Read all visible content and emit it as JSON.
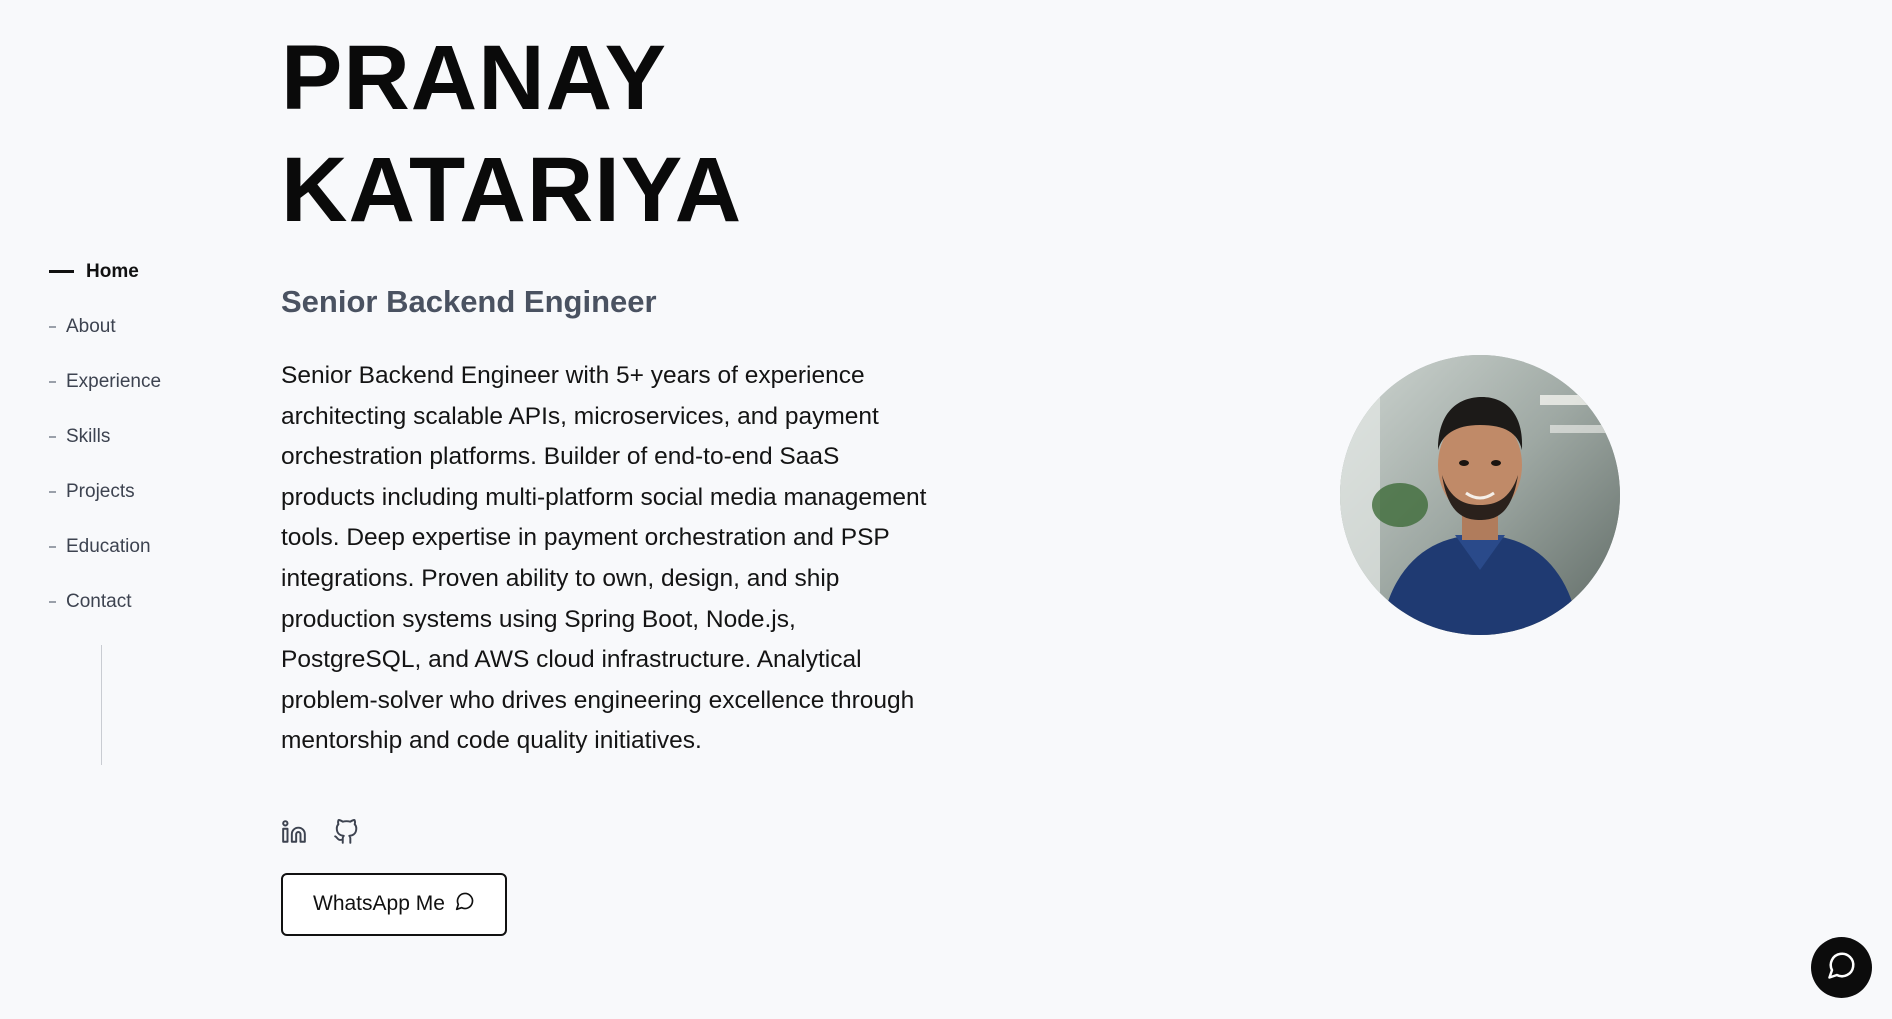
{
  "hero": {
    "first_name": "PRANAY",
    "last_name": "KATARIYA",
    "role": "Senior Backend Engineer",
    "summary": "Senior Backend Engineer with 5+ years of experience architecting scalable APIs, microservices, and payment orchestration platforms. Builder of end-to-end SaaS products including multi-platform social media management tools. Deep expertise in payment orchestration and PSP integrations. Proven ability to own, design, and ship production systems using Spring Boot, Node.js, PostgreSQL, and AWS cloud infrastructure. Analytical problem-solver who drives engineering excellence through mentorship and code quality initiatives.",
    "whatsapp_label": "WhatsApp Me"
  },
  "nav": {
    "items": [
      {
        "label": "Home",
        "active": true
      },
      {
        "label": "About",
        "active": false
      },
      {
        "label": "Experience",
        "active": false
      },
      {
        "label": "Skills",
        "active": false
      },
      {
        "label": "Projects",
        "active": false
      },
      {
        "label": "Education",
        "active": false
      },
      {
        "label": "Contact",
        "active": false
      }
    ]
  },
  "socials": [
    {
      "icon": "linkedin-icon"
    },
    {
      "icon": "github-icon"
    }
  ],
  "icons": {
    "whatsapp_button_icon": "chat-bubble-icon",
    "fab_icon": "chat-bubble-icon"
  },
  "colors": {
    "background": "#f8f9fb",
    "text": "#111111",
    "muted": "#4a5261",
    "fab": "#0c0c0c"
  }
}
